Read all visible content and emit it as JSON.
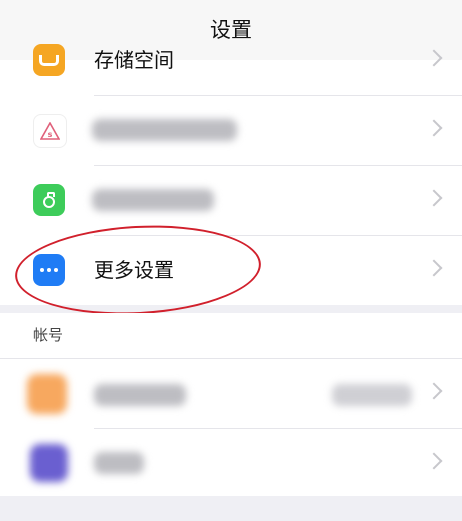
{
  "navbar": {
    "title": "设置"
  },
  "settings": {
    "storage_label": "存储空间",
    "more_settings_label": "更多设置",
    "items": [
      {
        "icon": "storage-icon",
        "color": "#f5a623"
      },
      {
        "icon": "s-triangle-icon",
        "color": "#ffffff"
      },
      {
        "icon": "bottle-icon",
        "color": "#3dcc5a"
      },
      {
        "icon": "more-dots-icon",
        "color": "#1f7cf5"
      }
    ]
  },
  "account": {
    "header": "帐号",
    "items": [
      {
        "icon": "orange-avatar-icon",
        "color": "#f7a85f"
      },
      {
        "icon": "purple-avatar-icon",
        "color": "#6a5fd0"
      }
    ]
  },
  "highlight": {
    "color": "#d1202c"
  }
}
